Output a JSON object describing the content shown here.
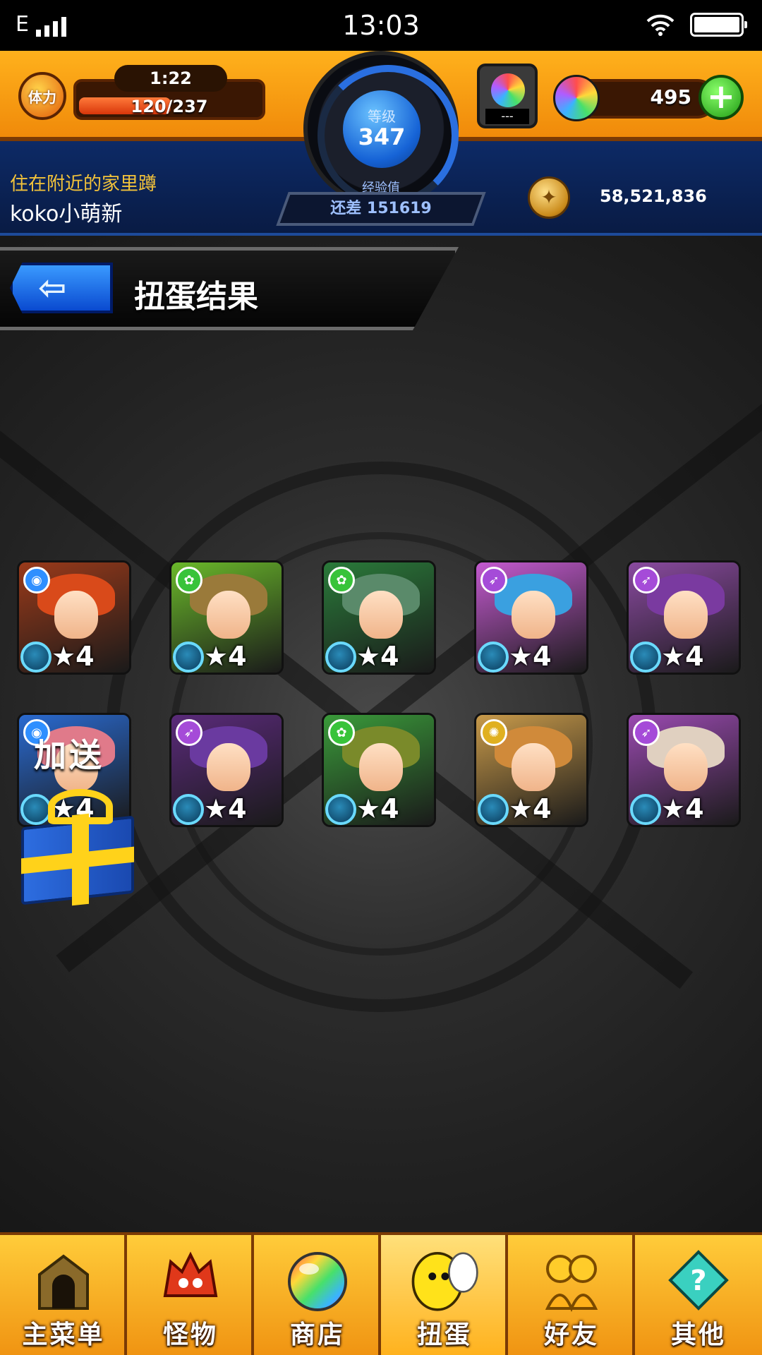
{
  "status_bar": {
    "network": "E",
    "time": "13:03"
  },
  "header": {
    "stamina_label": "体力",
    "stamina_timer": "1:22",
    "stamina_value": "120/237",
    "stamina_fraction": 0.506,
    "level_label": "等级",
    "level_value": "347",
    "exp_label": "经验值",
    "exp_remaining": "还差 151619",
    "orb_slot_text": "---",
    "orb_count": "495",
    "add_label": "+",
    "player_title": "住在附近的家里蹲",
    "player_name": "koko小萌新",
    "coin_count": "58,521,836"
  },
  "page": {
    "back_icon": "back-arrow-icon",
    "title": "扭蛋结果",
    "bonus_label": "加送"
  },
  "results": [
    {
      "element": "water",
      "color": "#2f8fff",
      "hair": "#d94a1a",
      "bg": "#9a3a1a",
      "rarity": "★4"
    },
    {
      "element": "wood",
      "color": "#38c33a",
      "hair": "#9a7a3a",
      "bg": "#6ab82a",
      "rarity": "★4"
    },
    {
      "element": "wood",
      "color": "#38c33a",
      "hair": "#5a8a6a",
      "bg": "#2a7a3a",
      "rarity": "★4"
    },
    {
      "element": "dark",
      "color": "#a54bd8",
      "hair": "#3aa0e0",
      "bg": "#c45ad0",
      "rarity": "★4"
    },
    {
      "element": "dark",
      "color": "#a54bd8",
      "hair": "#7a3aa0",
      "bg": "#8a4aa0",
      "rarity": "★4"
    },
    {
      "element": "water",
      "color": "#2f8fff",
      "hair": "#e07a8a",
      "bg": "#2a6ad0",
      "rarity": "★4"
    },
    {
      "element": "dark",
      "color": "#a54bd8",
      "hair": "#6a3aa0",
      "bg": "#5a2a7a",
      "rarity": "★4"
    },
    {
      "element": "wood",
      "color": "#38c33a",
      "hair": "#7a8a2a",
      "bg": "#3a9a3a",
      "rarity": "★4"
    },
    {
      "element": "light",
      "color": "#e0b020",
      "hair": "#d08a3a",
      "bg": "#c89a4a",
      "rarity": "★4"
    },
    {
      "element": "dark",
      "color": "#a54bd8",
      "hair": "#e0d0c0",
      "bg": "#9a4ab0",
      "rarity": "★4"
    }
  ],
  "nav": [
    {
      "label": "主菜单",
      "icon": "home-gate-icon",
      "name": "nav-main-menu"
    },
    {
      "label": "怪物",
      "icon": "monster-icon",
      "name": "nav-monsters"
    },
    {
      "label": "商店",
      "icon": "orb-icon",
      "name": "nav-shop"
    },
    {
      "label": "扭蛋",
      "icon": "egg-icon",
      "name": "nav-gacha",
      "active": true
    },
    {
      "label": "好友",
      "icon": "friends-icon",
      "name": "nav-friends"
    },
    {
      "label": "其他",
      "icon": "help-icon",
      "name": "nav-other"
    }
  ]
}
